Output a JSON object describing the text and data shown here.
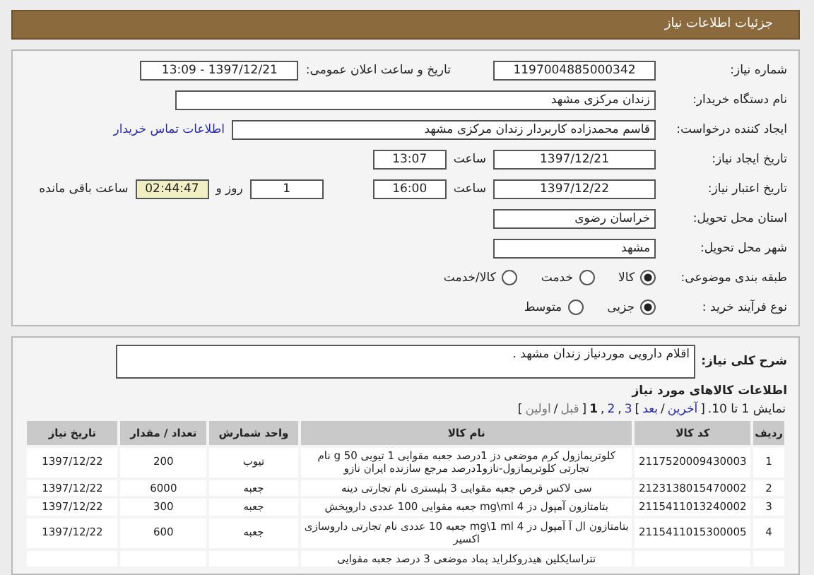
{
  "header": {
    "title": "جزئیات اطلاعات نیاز"
  },
  "form": {
    "need_number": {
      "label": "شماره نیاز:",
      "value": "1197004885000342"
    },
    "announce": {
      "label": "تاریخ و ساعت اعلان عمومی:",
      "value": "1397/12/21 - 13:09"
    },
    "buyer": {
      "label": "نام دستگاه خریدار:",
      "value": "زندان مرکزی مشهد"
    },
    "creator": {
      "label": "ایجاد کننده درخواست:",
      "value": "قاسم محمدزاده کاربردار زندان مرکزی مشهد",
      "link": "اطلاعات تماس خریدار"
    },
    "created": {
      "label": "تاریخ ایجاد نیاز:",
      "date": "1397/12/21",
      "time_label": "ساعت",
      "time": "13:07"
    },
    "validity": {
      "label": "تاریخ اعتبار نیاز:",
      "date": "1397/12/22",
      "time_label": "ساعت",
      "time": "16:00",
      "days": "1",
      "days_label": "روز و",
      "remaining": "02:44:47",
      "remaining_label": "ساعت باقی مانده"
    },
    "province": {
      "label": "استان محل تحویل:",
      "value": "خراسان رضوی"
    },
    "city": {
      "label": "شهر محل تحویل:",
      "value": "مشهد"
    },
    "category": {
      "label": "طبقه بندی موضوعی:",
      "options": [
        {
          "label": "کالا",
          "selected": true
        },
        {
          "label": "خدمت",
          "selected": false
        },
        {
          "label": "کالا/خدمت",
          "selected": false
        }
      ]
    },
    "process": {
      "label": "نوع فرآیند خرید :",
      "options": [
        {
          "label": "جزیی",
          "selected": true
        },
        {
          "label": "متوسط",
          "selected": false
        }
      ]
    }
  },
  "description": {
    "label": "شرح کلی نیاز:",
    "value": "اقلام دارویی موردنیاز زندان مشهد ."
  },
  "goods": {
    "title": "اطلاعات کالاهای مورد نیاز",
    "pagination": [
      {
        "text": "نمایش 1 تا 10.",
        "kind": "text"
      },
      {
        "text": "[",
        "kind": "text"
      },
      {
        "text": "آخرین",
        "kind": "link"
      },
      {
        "text": "/",
        "kind": "text"
      },
      {
        "text": "بعد",
        "kind": "link"
      },
      {
        "text": "]",
        "kind": "text"
      },
      {
        "text": "3",
        "kind": "link"
      },
      {
        "text": ",",
        "kind": "text"
      },
      {
        "text": "2",
        "kind": "link"
      },
      {
        "text": ",",
        "kind": "text"
      },
      {
        "text": "1",
        "kind": "current"
      },
      {
        "text": "[",
        "kind": "text"
      },
      {
        "text": "قبل",
        "kind": "disabled"
      },
      {
        "text": "/",
        "kind": "text"
      },
      {
        "text": "اولین",
        "kind": "disabled"
      },
      {
        "text": "]",
        "kind": "text"
      }
    ],
    "columns": [
      "ردیف",
      "کد کالا",
      "نام کالا",
      "واحد شمارش",
      "تعداد / مقدار",
      "تاریخ نیاز"
    ],
    "rows": [
      {
        "index": "1",
        "code": "2117520009430003",
        "name": "کلوتریمازول کرم موضعی دز 1درصد جعبه مقوایی 1 تیوبی 50 g نام تجارتی کلوتریمازول-نازو1درصد مرجع سازنده ایران نازو",
        "unit": "تیوب",
        "qty": "200",
        "date": "1397/12/22"
      },
      {
        "index": "2",
        "code": "2123138015470002",
        "name": "سی لاکس قرص جعبه مقوایی 3 بلیستری نام تجارتی دینه",
        "unit": "جعبه",
        "qty": "6000",
        "date": "1397/12/22"
      },
      {
        "index": "3",
        "code": "2115411013240002",
        "name": "بتامتازون آمپول دز 4 mg\\ml جعبه مقوایی 100 عددی داروپخش",
        "unit": "جعبه",
        "qty": "300",
        "date": "1397/12/22"
      },
      {
        "index": "4",
        "code": "2115411015300005",
        "name": "بتامتازون ال آ آمپول دز 4 mg\\1 ml جعبه 10 عددی نام تجارتی داروسازی اکسیر",
        "unit": "جعبه",
        "qty": "600",
        "date": "1397/12/22"
      },
      {
        "name": "تتراسایکلین هیدروکلراید پماد موضعی 3 درصد جعبه مقوایی"
      }
    ]
  }
}
